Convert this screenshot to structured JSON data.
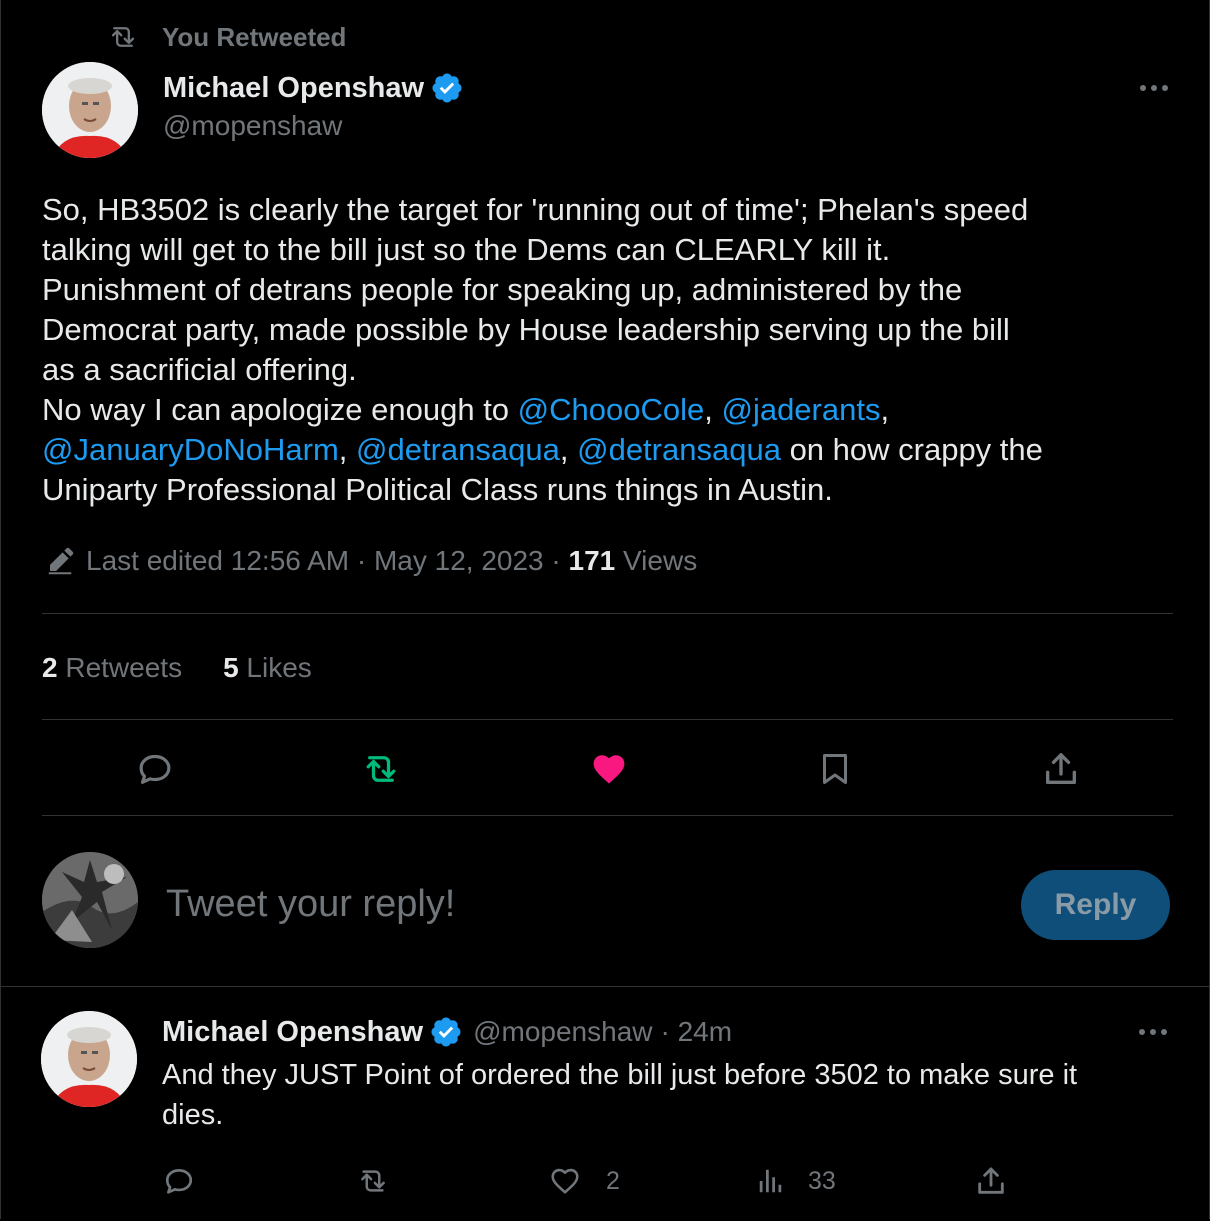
{
  "retweet_banner": {
    "label": "You Retweeted"
  },
  "main_tweet": {
    "author_name": "Michael Openshaw",
    "handle": "@mopenshaw",
    "text_line1": "So, HB3502 is clearly the target for 'running out of time'; Phelan's speed",
    "text_line2": "talking will get to the bill just so the Dems can CLEARLY kill it.",
    "text_line3": "Punishment of detrans people for speaking up, administered by the",
    "text_line4": "Democrat party, made possible by House leadership serving up the bill",
    "text_line5": "as a sacrificial offering.",
    "text_line6_prefix": "No way I can apologize enough to ",
    "mention1": "@ChoooCole",
    "sep1": ", ",
    "mention2": "@jaderants",
    "sep2": ",",
    "mention3": "@JanuaryDoNoHarm",
    "sep3": ", ",
    "mention4": "@detransaqua",
    "sep4": ", ",
    "mention5": "@detransaqua",
    "text_line7_suffix": " on how crappy the",
    "text_line8": "Uniparty Professional Political Class runs things in Austin.",
    "edited_label": "Last edited 12:56 AM · May 12, 2023",
    "dot": " · ",
    "views_count": "171",
    "views_label": " Views",
    "retweets_count": "2",
    "retweets_label": " Retweets",
    "likes_count": "5",
    "likes_label": " Likes"
  },
  "action_bar": {
    "icons": [
      "reply-icon",
      "retweet-icon",
      "like-icon",
      "bookmark-icon",
      "share-icon"
    ],
    "retweet_color": "#00ba7c",
    "like_color": "#f91880"
  },
  "composer": {
    "placeholder": "Tweet your reply!",
    "reply_button": "Reply",
    "reply_button_color": "#1d9bf0"
  },
  "reply_tweet": {
    "author_name": "Michael Openshaw",
    "handle": "@mopenshaw",
    "time": "· 24m",
    "text_line1": "And they JUST Point of ordered the bill just before 3502 to make sure it",
    "text_line2": "dies.",
    "likes": "2",
    "views": "33"
  },
  "colors": {
    "background": "#000000",
    "text": "#e7e9ea",
    "muted": "#71767b",
    "link": "#1d9bf0",
    "divider": "#2f3336",
    "verified": "#1d9bf0"
  }
}
